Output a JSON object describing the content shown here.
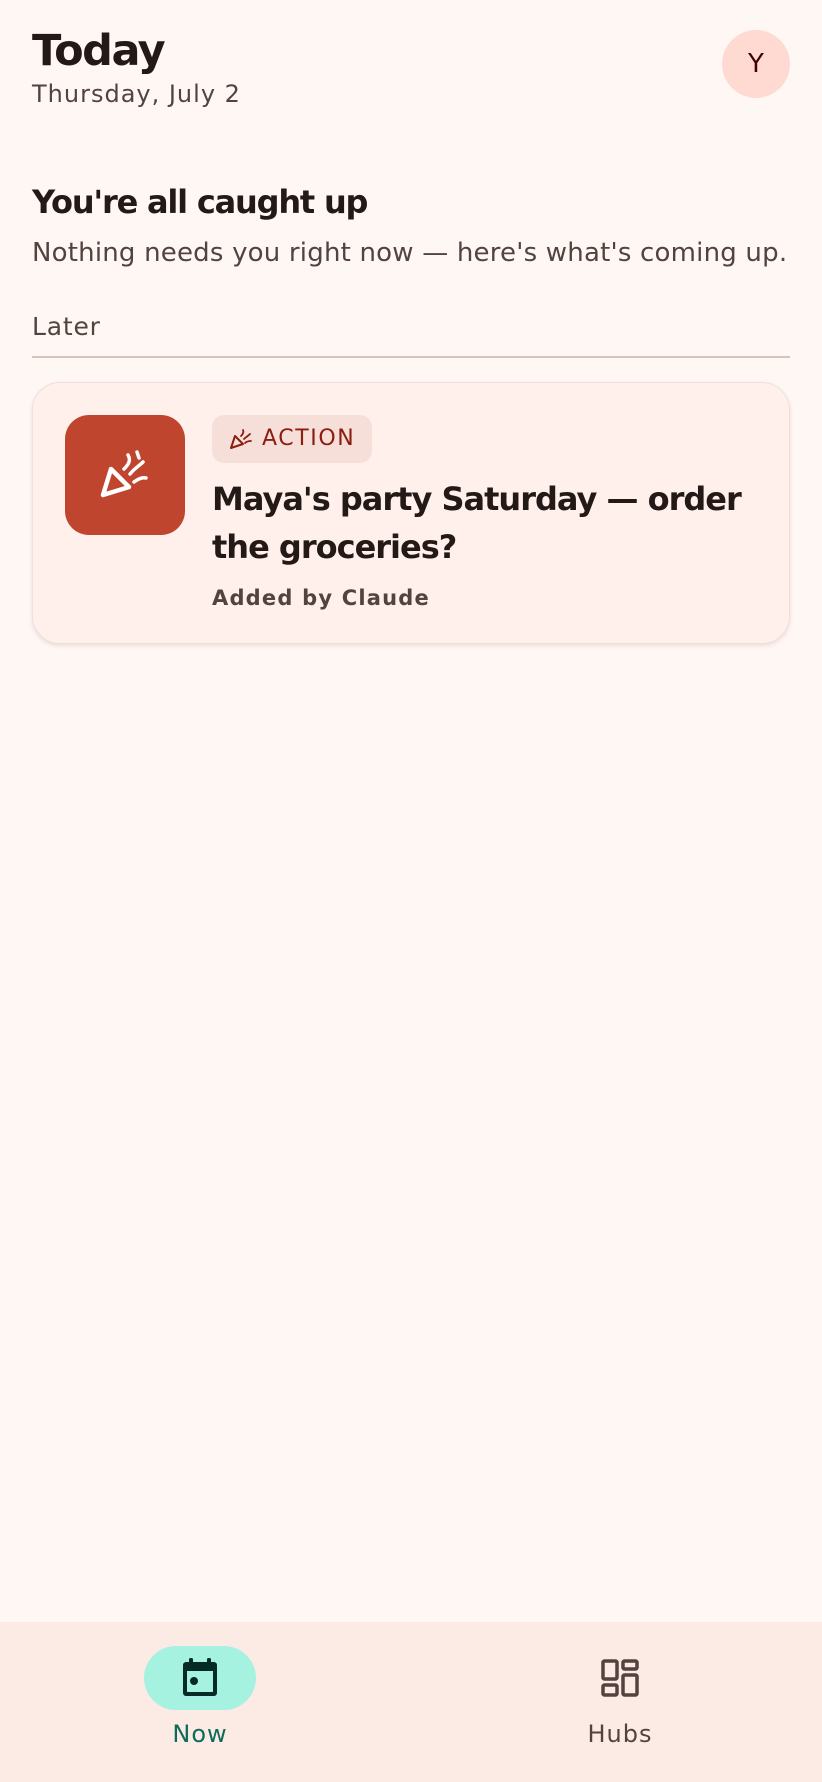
{
  "header": {
    "title": "Today",
    "date": "Thursday, July 2",
    "avatar_initial": "Y"
  },
  "status": {
    "title": "You're all caught up",
    "subtitle": "Nothing needs you right now — here's what's coming up."
  },
  "section": {
    "label": "Later"
  },
  "card": {
    "icon": "party-popper-icon",
    "chip_icon": "party-popper-icon",
    "chip_label": "ACTION",
    "title": "Maya's party Saturday — order the groceries?",
    "meta": "Added by Claude"
  },
  "nav": {
    "items": [
      {
        "label": "Now",
        "icon": "calendar-today-icon",
        "active": true
      },
      {
        "label": "Hubs",
        "icon": "dashboard-grid-icon",
        "active": false
      }
    ]
  },
  "colors": {
    "background": "#FFF7F4",
    "avatar_bg": "#FFDAD2",
    "card_bg": "#FFF0EC",
    "icon_tile": "#C0452F",
    "chip_bg": "#F6DFD9",
    "chip_text": "#8C1D0F",
    "nav_bg": "#FCEAE5",
    "nav_active_indicator": "#A6F2E1",
    "nav_active_label": "#0E6B5C"
  }
}
